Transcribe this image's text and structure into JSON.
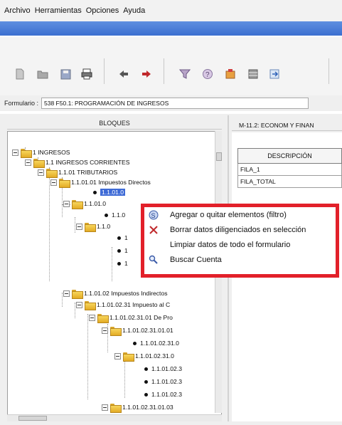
{
  "menu": [
    "Archivo",
    "Herramientas",
    "Opciones",
    "Ayuda"
  ],
  "toolbar": {
    "left_icons": [
      "new-document-icon",
      "open-folder-icon",
      "save-icon",
      "print-icon"
    ],
    "mid_icons": [
      "back-icon",
      "forward-icon"
    ],
    "right_icons": [
      "filter-icon",
      "help-icon",
      "building-icon",
      "table-icon",
      "export-icon"
    ]
  },
  "form": {
    "label": "Formulario :",
    "value": "538 F50.1: PROGRAMACIÓN DE INGRESOS"
  },
  "left_panel": {
    "title": "BLOQUES"
  },
  "tree": [
    {
      "label": "1 INGRESOS",
      "type": "folder"
    },
    {
      "label": "1.1 INGRESOS CORRIENTES",
      "type": "folder"
    },
    {
      "label": "1.1.01 TRIBUTARIOS",
      "type": "folder"
    },
    {
      "label": "1.1.01.01 Impuestos Directos",
      "type": "folder"
    },
    {
      "label": "1.1.01.0",
      "type": "leaf",
      "selected": true
    },
    {
      "label": "1.1.01.0",
      "type": "folder"
    },
    {
      "label": "1.1.0",
      "type": "leaf"
    },
    {
      "label": "1.1.0",
      "type": "folder"
    },
    {
      "label": "1",
      "type": "leaf"
    },
    {
      "label": "1",
      "type": "leaf"
    },
    {
      "label": "1",
      "type": "leaf"
    },
    {
      "label": "1.1.01.02 Impuestos Indirectos",
      "type": "folder"
    },
    {
      "label": "1.1.01.02.31 Impuesto al C",
      "type": "folder"
    },
    {
      "label": "1.1.01.02.31.01 De Pro",
      "type": "folder"
    },
    {
      "label": "1.1.01.02.31.01.01",
      "type": "folder"
    },
    {
      "label": "1.1.01.02.31.0",
      "type": "leaf"
    },
    {
      "label": "1.1.01.02.31.0",
      "type": "folder"
    },
    {
      "label": "1.1.01.02.3",
      "type": "leaf"
    },
    {
      "label": "1.1.01.02.3",
      "type": "leaf"
    },
    {
      "label": "1.1.01.02.3",
      "type": "leaf"
    },
    {
      "label": "1.1.01.02.31.01.03",
      "type": "folder"
    }
  ],
  "right_panel": {
    "tab_label": "M-11.2: ECONOM Y FINAN",
    "grid_header": "DESCRIPCIÓN",
    "rows": [
      "FILA_1",
      "FILA_TOTAL"
    ]
  },
  "context_menu": {
    "items": [
      {
        "label": "Agregar o quitar elementos (filtro)",
        "icon": "filter-icon"
      },
      {
        "label": "Borrar datos diligenciados en selección",
        "icon": "delete-x-icon"
      },
      {
        "label": "Limpiar datos de todo el formulario",
        "icon": ""
      },
      {
        "label": "Buscar Cuenta",
        "icon": "search-icon"
      }
    ],
    "highlight_color": "#e2202a"
  },
  "colors": {
    "selection": "#3d6ad6",
    "titlebar": "#3b6fd0"
  }
}
